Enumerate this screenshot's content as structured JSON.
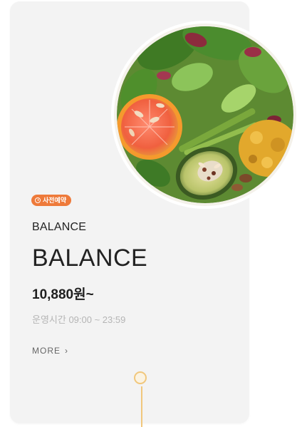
{
  "card": {
    "badge_label": "사전예약",
    "brand_small": "BALANCE",
    "brand_large": "BALANCE",
    "price": "10,880원~",
    "hours": "운영시간 09:00 ~ 23:59",
    "more_label": "MORE",
    "more_icon": "chevron-right-icon",
    "badge_icon": "clock-icon",
    "image_subject": "salad-bowl-image"
  },
  "colors": {
    "card_bg": "#f3f3f3",
    "badge": "#ee7a3a",
    "timeline": "#f1c77c",
    "text_dark": "#222222",
    "text_muted": "#b5b5b5"
  }
}
